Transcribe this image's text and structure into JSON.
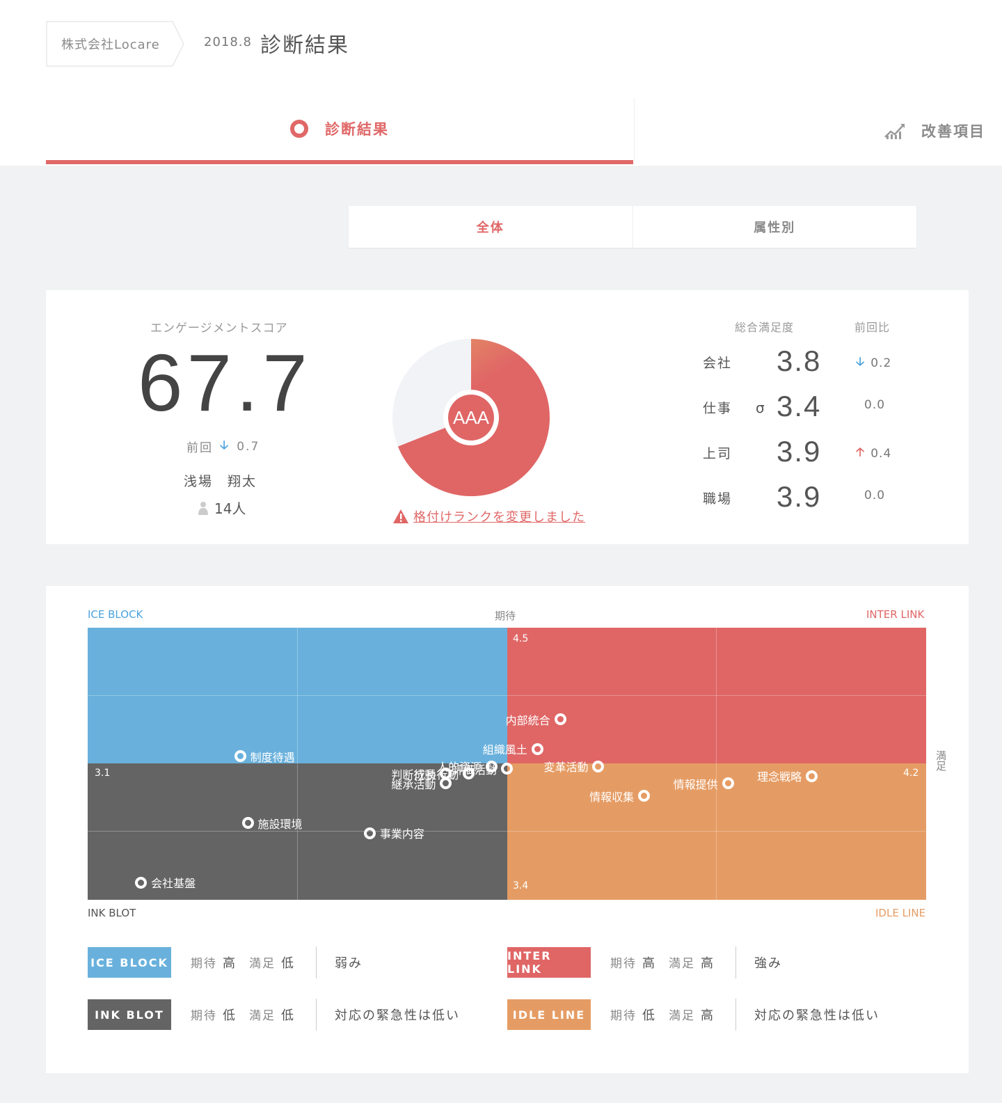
{
  "header": {
    "company": "株式会社Locare",
    "date": "2018.8",
    "title": "診断結果"
  },
  "tabs": {
    "diagnosis": "診断結果",
    "improvement": "改善項目"
  },
  "segment": {
    "all": "全体",
    "by_attribute": "属性別"
  },
  "summary": {
    "score_label": "エンゲージメントスコア",
    "score": "67.7",
    "prev_label": "前回",
    "prev_diff": "0.7",
    "manager": "浅場　翔太",
    "members": "14人",
    "rank": "AAA",
    "rank_fraction": 0.69,
    "rank_warning": "格付けランクを変更しました"
  },
  "satisfaction": {
    "header_total": "総合満足度",
    "header_prev": "前回比",
    "rows": [
      {
        "label": "会社",
        "sigma": "",
        "value": "3.8",
        "diff": "0.2",
        "trend": "down"
      },
      {
        "label": "仕事",
        "sigma": "σ",
        "value": "3.4",
        "diff": "0.0",
        "trend": "none"
      },
      {
        "label": "上司",
        "sigma": "",
        "value": "3.9",
        "diff": "0.4",
        "trend": "up"
      },
      {
        "label": "職場",
        "sigma": "",
        "value": "3.9",
        "diff": "0.0",
        "trend": "none"
      }
    ]
  },
  "matrix": {
    "top_left": "ICE BLOCK",
    "top_center": "期待",
    "top_right": "INTER LINK",
    "bottom_left": "INK BLOT",
    "bottom_right": "IDLE LINE",
    "right_axis": "満足",
    "ticks": {
      "top": "4.5",
      "left": "3.1",
      "right": "4.2",
      "bottom": "3.4"
    },
    "colors": {
      "ice": "#69b1dc",
      "inter": "#e06666",
      "ink": "#646464",
      "idle": "#e59c64"
    },
    "points": [
      {
        "name": "内部統合",
        "sat": 3.72,
        "exp": 4.13
      },
      {
        "name": "制度待遇",
        "sat": 3.3,
        "exp": 3.98
      },
      {
        "name": "組織風土",
        "sat": 3.69,
        "exp": 4.01
      },
      {
        "name": "変革活動",
        "sat": 3.77,
        "exp": 3.94
      },
      {
        "name": "人的資源",
        "sat": 3.63,
        "exp": 3.94
      },
      {
        "name": "評価活動",
        "sat": 3.65,
        "exp": 3.93
      },
      {
        "name": "判断行動",
        "sat": 3.57,
        "exp": 3.91
      },
      {
        "name": "成長行動",
        "sat": 3.6,
        "exp": 3.91
      },
      {
        "name": "継承活動",
        "sat": 3.57,
        "exp": 3.87
      },
      {
        "name": "理念戦略",
        "sat": 4.05,
        "exp": 3.9
      },
      {
        "name": "情報提供",
        "sat": 3.94,
        "exp": 3.87
      },
      {
        "name": "情報収集",
        "sat": 3.83,
        "exp": 3.82
      },
      {
        "name": "施設環境",
        "sat": 3.31,
        "exp": 3.71
      },
      {
        "name": "事業内容",
        "sat": 3.47,
        "exp": 3.67
      },
      {
        "name": "会社基盤",
        "sat": 3.17,
        "exp": 3.47
      }
    ]
  },
  "legend": [
    {
      "badge": "ICE BLOCK",
      "exp_label": "期待",
      "exp_level": "高",
      "sat_label": "満足",
      "sat_level": "低",
      "desc": "弱み",
      "color": "#69b1dc"
    },
    {
      "badge": "INTER LINK",
      "exp_label": "期待",
      "exp_level": "高",
      "sat_label": "満足",
      "sat_level": "高",
      "desc": "強み",
      "color": "#e06666"
    },
    {
      "badge": "INK BLOT",
      "exp_label": "期待",
      "exp_level": "低",
      "sat_label": "満足",
      "sat_level": "低",
      "desc": "対応の緊急性は低い",
      "color": "#646464"
    },
    {
      "badge": "IDLE LINE",
      "exp_label": "期待",
      "exp_level": "低",
      "sat_label": "満足",
      "sat_level": "高",
      "desc": "対応の緊急性は低い",
      "color": "#e59c64"
    }
  ]
}
